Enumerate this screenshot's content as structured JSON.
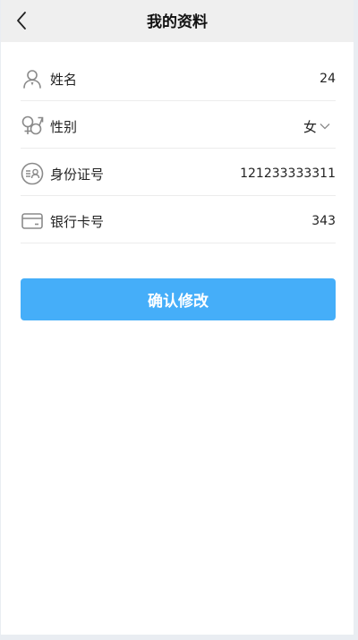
{
  "header": {
    "title": "我的资料"
  },
  "form": {
    "rows": [
      {
        "label": "姓名",
        "value": "24",
        "icon": "user-icon"
      },
      {
        "label": "性别",
        "value": "女",
        "icon": "gender-icon"
      },
      {
        "label": "身份证号",
        "value": "121233333311",
        "icon": "id-card-icon"
      },
      {
        "label": "银行卡号",
        "value": "343",
        "icon": "bank-card-icon"
      }
    ]
  },
  "actions": {
    "confirm_label": "确认修改"
  },
  "colors": {
    "accent": "#45aef9",
    "header_bg": "#efefef",
    "icon_gray": "#8a8a8a"
  }
}
